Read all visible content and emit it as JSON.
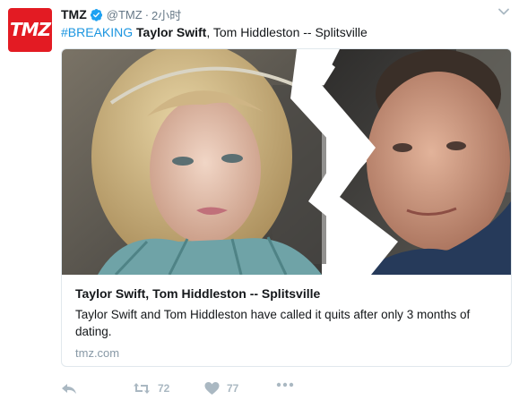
{
  "account": {
    "avatar_text": "TMZ",
    "display_name": "TMZ",
    "handle": "@TMZ",
    "separator": "·",
    "time": "2小时"
  },
  "icons": {
    "verified": "verified-badge-icon",
    "caret": "chevron-down-icon",
    "reply": "reply-icon",
    "retweet": "retweet-icon",
    "like": "heart-icon",
    "more": "more-icon"
  },
  "tweet": {
    "hashtag": "#BREAKING",
    "headline_bold": "Taylor Swift",
    "headline_rest": ", Tom Hiddleston -- Splitsville"
  },
  "card": {
    "title": "Taylor Swift, Tom Hiddleston -- Splitsville",
    "description": "Taylor Swift and Tom Hiddleston have called it quits after only 3 months of dating.",
    "domain": "tmz.com"
  },
  "actions": {
    "retweet_count": "72",
    "like_count": "77"
  },
  "colors": {
    "brand": "#e31b23",
    "link": "#1b95e0",
    "verified": "#1da1f2",
    "muted": "#657786",
    "action": "#aab8c2"
  }
}
